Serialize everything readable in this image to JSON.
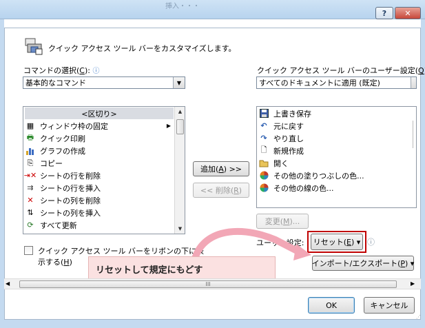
{
  "dialog": {
    "title_fragment": "挿入・・・"
  },
  "titlebar": {
    "help_label": "?",
    "close_label": "✕"
  },
  "header": {
    "text": "クイック アクセス ツール バーをカスタマイズします。"
  },
  "left": {
    "choose_label_pre": "コマンドの選択(",
    "choose_label_key": "C",
    "choose_label_post": "):",
    "combo_value": "基本的なコマンド",
    "items": [
      {
        "label": "<区切り>",
        "icon": "separator"
      },
      {
        "label": "ウィンドウ枠の固定",
        "icon": "freeze-panes-icon",
        "submenu": "▶"
      },
      {
        "label": "クイック印刷",
        "icon": "quick-print-icon"
      },
      {
        "label": "グラフの作成",
        "icon": "chart-icon"
      },
      {
        "label": "コピー",
        "icon": "copy-icon"
      },
      {
        "label": "シートの行を削除",
        "icon": "delete-row-icon"
      },
      {
        "label": "シートの行を挿入",
        "icon": "insert-row-icon"
      },
      {
        "label": "シートの列を削除",
        "icon": "delete-col-icon"
      },
      {
        "label": "シートの列を挿入",
        "icon": "insert-col-icon"
      },
      {
        "label": "すべて更新",
        "icon": "refresh-icon"
      }
    ],
    "checkbox_label_line1": "クイック アクセス ツール バーをリボンの下に表",
    "checkbox_label_line2_pre": "示する(",
    "checkbox_label_key": "H",
    "checkbox_label_line2_post": ")"
  },
  "middle": {
    "add_pre": "追加(",
    "add_key": "A",
    "add_post": ") >>",
    "remove_pre": "<< 削除(",
    "remove_key": "R",
    "remove_post": ")"
  },
  "right": {
    "customize_label_pre": "クイック アクセス ツール バーのユーザー設定(",
    "customize_label_key": "Q",
    "customize_label_post": "):",
    "combo_value": "すべてのドキュメントに適用 (既定)",
    "items": [
      {
        "label": "上書き保存",
        "icon": "save-icon"
      },
      {
        "label": "元に戻す",
        "icon": "undo-icon"
      },
      {
        "label": "やり直し",
        "icon": "redo-icon"
      },
      {
        "label": "新規作成",
        "icon": "new-doc-icon"
      },
      {
        "label": "開く",
        "icon": "open-folder-icon"
      },
      {
        "label": "その他の塗りつぶしの色...",
        "icon": "fill-color-icon"
      },
      {
        "label": "その他の線の色...",
        "icon": "line-color-icon"
      }
    ],
    "modify_pre": "変更(",
    "modify_key": "M",
    "modify_post": ")...",
    "user_settings_label": "ユーザー設定:",
    "reset_pre": "リセット(",
    "reset_key": "E",
    "reset_post": ") ▾",
    "info_glyph": "ⓘ",
    "import_export_pre": "インポート/エクスポート(",
    "import_export_key": "P",
    "import_export_post": ") ▾"
  },
  "callout": {
    "text": "リセットして規定にもどす"
  },
  "footer": {
    "ok_label": "OK",
    "cancel_label": "キャンセル",
    "scroll_thumb_glyph": "III"
  },
  "colors": {
    "title_gradient_top": "#cfe3f5",
    "callout_bg": "#fbe1e1",
    "highlight_border": "#c00000",
    "arrow_pink": "#f2a7b6"
  }
}
